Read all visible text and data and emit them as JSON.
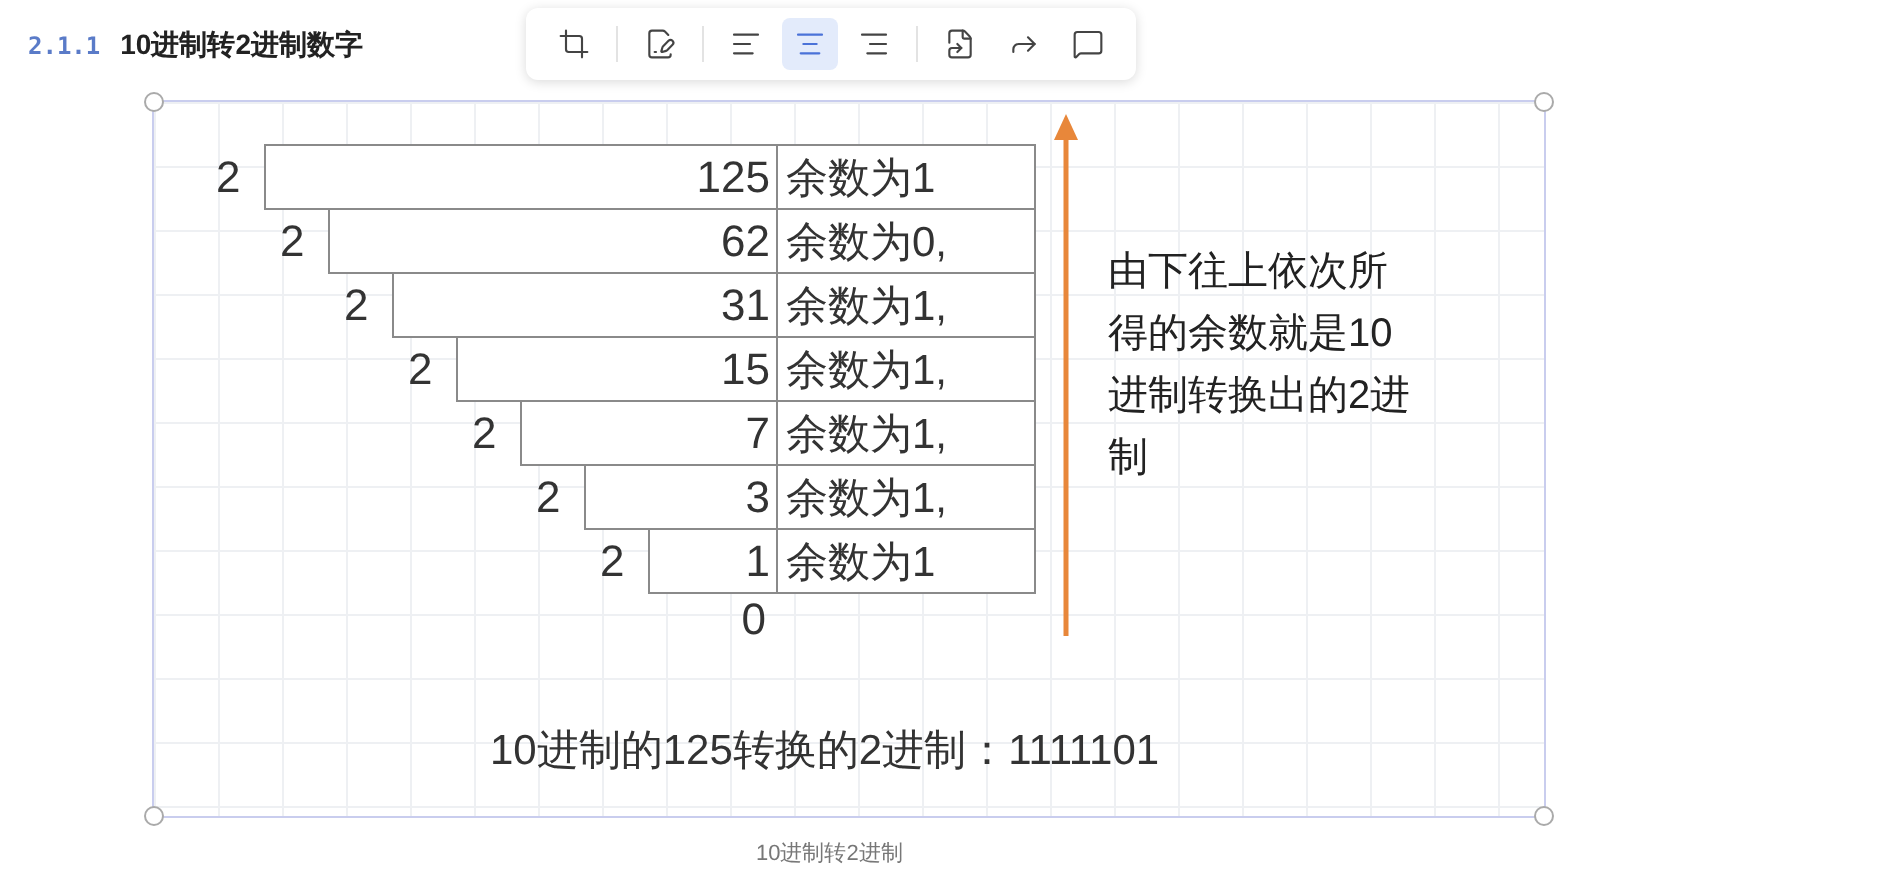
{
  "heading": {
    "number": "2.1.1",
    "title": "10进制转2进制数字"
  },
  "toolbar": {
    "groups": [
      [
        {
          "selected": false
        }
      ],
      [
        {
          "selected": false
        }
      ],
      [
        {
          "selected": false
        },
        {
          "selected": true
        },
        {
          "selected": false
        }
      ],
      [
        {
          "selected": false
        },
        {
          "selected": false
        },
        {
          "selected": false
        }
      ]
    ]
  },
  "division": {
    "rows": [
      {
        "divisor": "2",
        "dividend": "125",
        "remainder": "余数为1"
      },
      {
        "divisor": "2",
        "dividend": "62",
        "remainder": "余数为0,"
      },
      {
        "divisor": "2",
        "dividend": "31",
        "remainder": "余数为1,"
      },
      {
        "divisor": "2",
        "dividend": "15",
        "remainder": "余数为1,"
      },
      {
        "divisor": "2",
        "dividend": "7",
        "remainder": "余数为1,"
      },
      {
        "divisor": "2",
        "dividend": "3",
        "remainder": "余数为1,"
      },
      {
        "divisor": "2",
        "dividend": "1",
        "remainder": "余数为1"
      }
    ],
    "final_quotient": "0"
  },
  "note": "由下往上依次所得的余数就是10进制转换出的2进制",
  "result": "10进制的125转换的2进制：1111101",
  "caption": "10进制转2进制"
}
